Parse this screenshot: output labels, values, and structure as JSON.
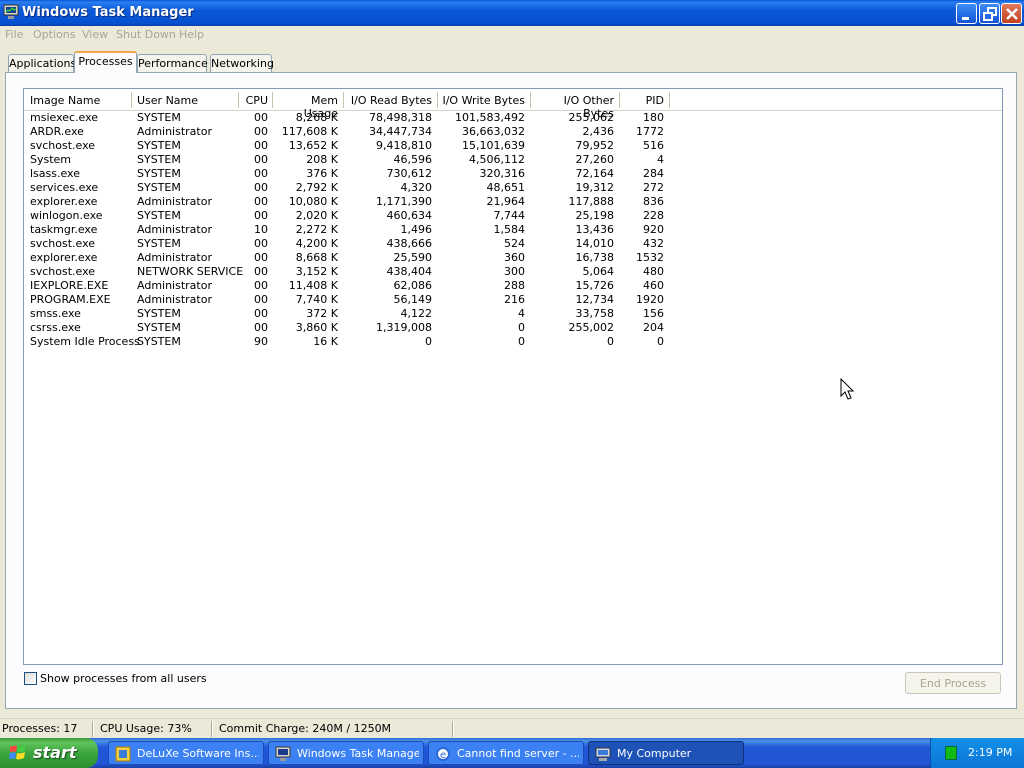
{
  "window": {
    "title": "Windows Task Manager"
  },
  "menu": [
    "File",
    "Options",
    "View",
    "Shut Down",
    "Help"
  ],
  "tabs": [
    "Applications",
    "Processes",
    "Performance",
    "Networking"
  ],
  "active_tab": "Processes",
  "columns": [
    "Image Name",
    "User Name",
    "CPU",
    "Mem Usage",
    "I/O Read Bytes",
    "I/O Write Bytes",
    "I/O Other Bytes",
    "PID"
  ],
  "processes": [
    [
      "msiexec.exe",
      "SYSTEM",
      "00",
      "8,268 K",
      "78,498,318",
      "101,583,492",
      "255,062",
      "180"
    ],
    [
      "ARDR.exe",
      "Administrator",
      "00",
      "117,608 K",
      "34,447,734",
      "36,663,032",
      "2,436",
      "1772"
    ],
    [
      "svchost.exe",
      "SYSTEM",
      "00",
      "13,652 K",
      "9,418,810",
      "15,101,639",
      "79,952",
      "516"
    ],
    [
      "System",
      "SYSTEM",
      "00",
      "208 K",
      "46,596",
      "4,506,112",
      "27,260",
      "4"
    ],
    [
      "lsass.exe",
      "SYSTEM",
      "00",
      "376 K",
      "730,612",
      "320,316",
      "72,164",
      "284"
    ],
    [
      "services.exe",
      "SYSTEM",
      "00",
      "2,792 K",
      "4,320",
      "48,651",
      "19,312",
      "272"
    ],
    [
      "explorer.exe",
      "Administrator",
      "00",
      "10,080 K",
      "1,171,390",
      "21,964",
      "117,888",
      "836"
    ],
    [
      "winlogon.exe",
      "SYSTEM",
      "00",
      "2,020 K",
      "460,634",
      "7,744",
      "25,198",
      "228"
    ],
    [
      "taskmgr.exe",
      "Administrator",
      "10",
      "2,272 K",
      "1,496",
      "1,584",
      "13,436",
      "920"
    ],
    [
      "svchost.exe",
      "SYSTEM",
      "00",
      "4,200 K",
      "438,666",
      "524",
      "14,010",
      "432"
    ],
    [
      "explorer.exe",
      "Administrator",
      "00",
      "8,668 K",
      "25,590",
      "360",
      "16,738",
      "1532"
    ],
    [
      "svchost.exe",
      "NETWORK SERVICE",
      "00",
      "3,152 K",
      "438,404",
      "300",
      "5,064",
      "480"
    ],
    [
      "IEXPLORE.EXE",
      "Administrator",
      "00",
      "11,408 K",
      "62,086",
      "288",
      "15,726",
      "460"
    ],
    [
      "PROGRAM.EXE",
      "Administrator",
      "00",
      "7,740 K",
      "56,149",
      "216",
      "12,734",
      "1920"
    ],
    [
      "smss.exe",
      "SYSTEM",
      "00",
      "372 K",
      "4,122",
      "4",
      "33,758",
      "156"
    ],
    [
      "csrss.exe",
      "SYSTEM",
      "00",
      "3,860 K",
      "1,319,008",
      "0",
      "255,002",
      "204"
    ],
    [
      "System Idle Process",
      "SYSTEM",
      "90",
      "16 K",
      "0",
      "0",
      "0",
      "0"
    ]
  ],
  "show_all_label": "Show processes from all users",
  "end_process_label": "End Process",
  "status": {
    "processes": "Processes: 17",
    "cpu": "CPU Usage: 73%",
    "commit": "Commit Charge: 240M / 1250M"
  },
  "taskbar": {
    "start": "start",
    "tasks": [
      "DeLuXe Software Ins...",
      "Windows Task Manager",
      "Cannot find server - ...",
      "My Computer"
    ],
    "active_task": "My Computer",
    "clock": "2:19 PM"
  },
  "colors": {
    "title_blue": "#0b58d8",
    "taskbar_blue": "#2157d7",
    "start_green": "#37a23b",
    "tab_highlight": "#f0a84c"
  }
}
